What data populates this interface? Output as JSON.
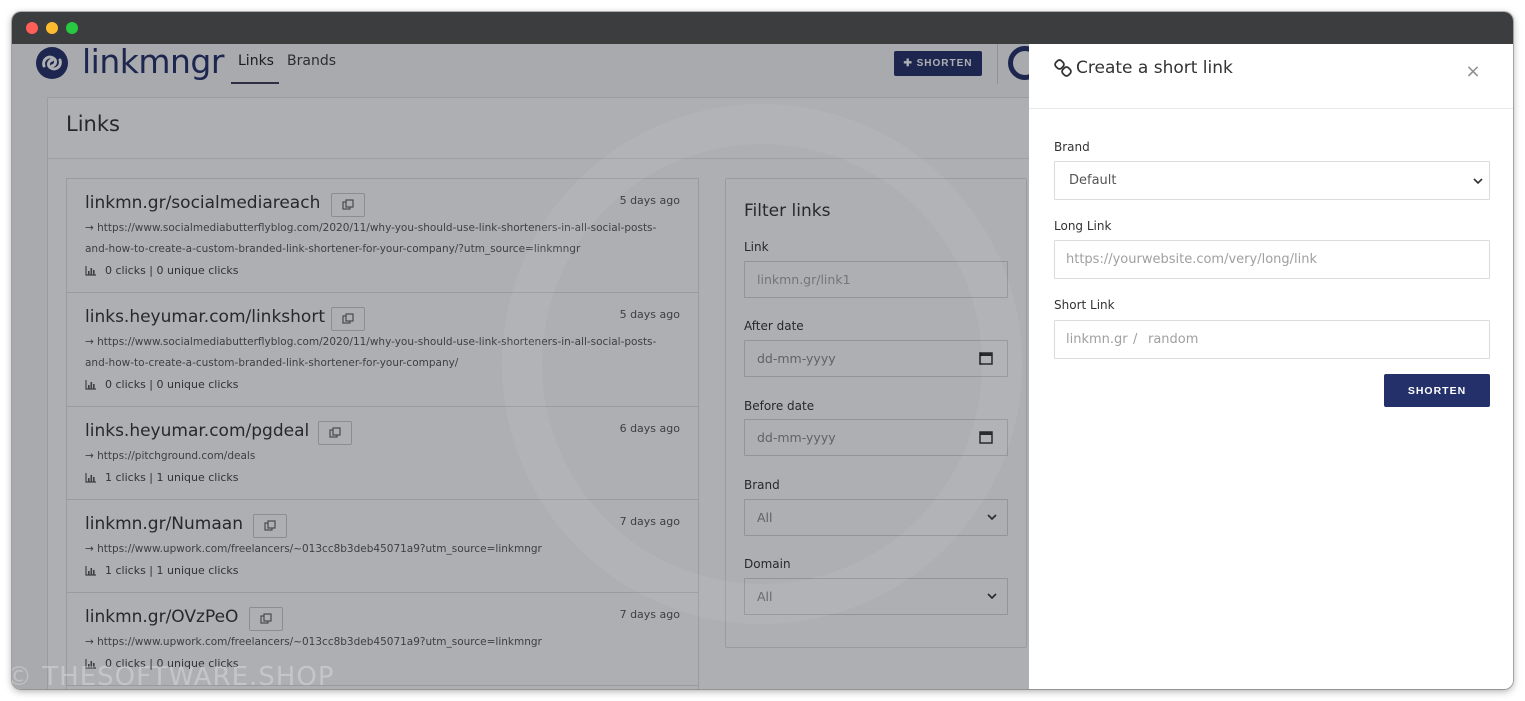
{
  "nav": {
    "brand": "linkmngr",
    "links_tab": "Links",
    "brands_tab": "Brands",
    "shorten_button": "✚ SHORTEN"
  },
  "page": {
    "title": "Links"
  },
  "links": [
    {
      "short": "linkmn.gr/socialmediareach",
      "age": "5 days ago",
      "long_1": "→ https://www.socialmediabutterflyblog.com/2020/11/why-you-should-use-link-shorteners-in-all-social-posts-",
      "long_2": "and-how-to-create-a-custom-branded-link-shortener-for-your-company/?utm_source=linkmngr",
      "stats": "0 clicks | 0 unique clicks"
    },
    {
      "short": "links.heyumar.com/linkshort",
      "age": "5 days ago",
      "long_1": "→ https://www.socialmediabutterflyblog.com/2020/11/why-you-should-use-link-shorteners-in-all-social-posts-",
      "long_2": "and-how-to-create-a-custom-branded-link-shortener-for-your-company/",
      "stats": "0 clicks | 0 unique clicks"
    },
    {
      "short": "links.heyumar.com/pgdeal",
      "age": "6 days ago",
      "long_1": "→ https://pitchground.com/deals",
      "long_2": "",
      "stats": "1 clicks | 1 unique clicks"
    },
    {
      "short": "linkmn.gr/Numaan",
      "age": "7 days ago",
      "long_1": "→ https://www.upwork.com/freelancers/~013cc8b3deb45071a9?utm_source=linkmngr",
      "long_2": "",
      "stats": "1 clicks | 1 unique clicks"
    },
    {
      "short": "linkmn.gr/OVzPeO",
      "age": "7 days ago",
      "long_1": "→ https://www.upwork.com/freelancers/~013cc8b3deb45071a9?utm_source=linkmngr",
      "long_2": "",
      "stats": "0 clicks | 0 unique clicks"
    }
  ],
  "filter": {
    "title": "Filter links",
    "link_label": "Link",
    "link_placeholder": "linkmn.gr/link1",
    "after_label": "After date",
    "after_placeholder": "dd-mm-yyyy",
    "before_label": "Before date",
    "before_placeholder": "dd-mm-yyyy",
    "brand_label": "Brand",
    "brand_value": "All",
    "domain_label": "Domain",
    "domain_value": "All"
  },
  "watermark": "© THESOFTWARE.SHOP",
  "panel": {
    "title": "Create a short link",
    "close": "×",
    "brand_label": "Brand",
    "brand_value": "Default",
    "long_label": "Long Link",
    "long_placeholder": "https://yourwebsite.com/very/long/link",
    "short_label": "Short Link",
    "short_domain": "linkmn.gr",
    "short_separator": "/",
    "short_placeholder": "random",
    "submit": "SHORTEN"
  },
  "colors": {
    "brand_navy": "#24306a",
    "close_red": "#fe5f57",
    "minimize_yellow": "#febb2e",
    "zoom_green": "#28c840"
  },
  "icons": {
    "copy": "copy-icon",
    "stats": "bar-chart-icon",
    "link": "chain-link-icon",
    "select": "chevron-down-icon",
    "date": "calendar-icon"
  }
}
